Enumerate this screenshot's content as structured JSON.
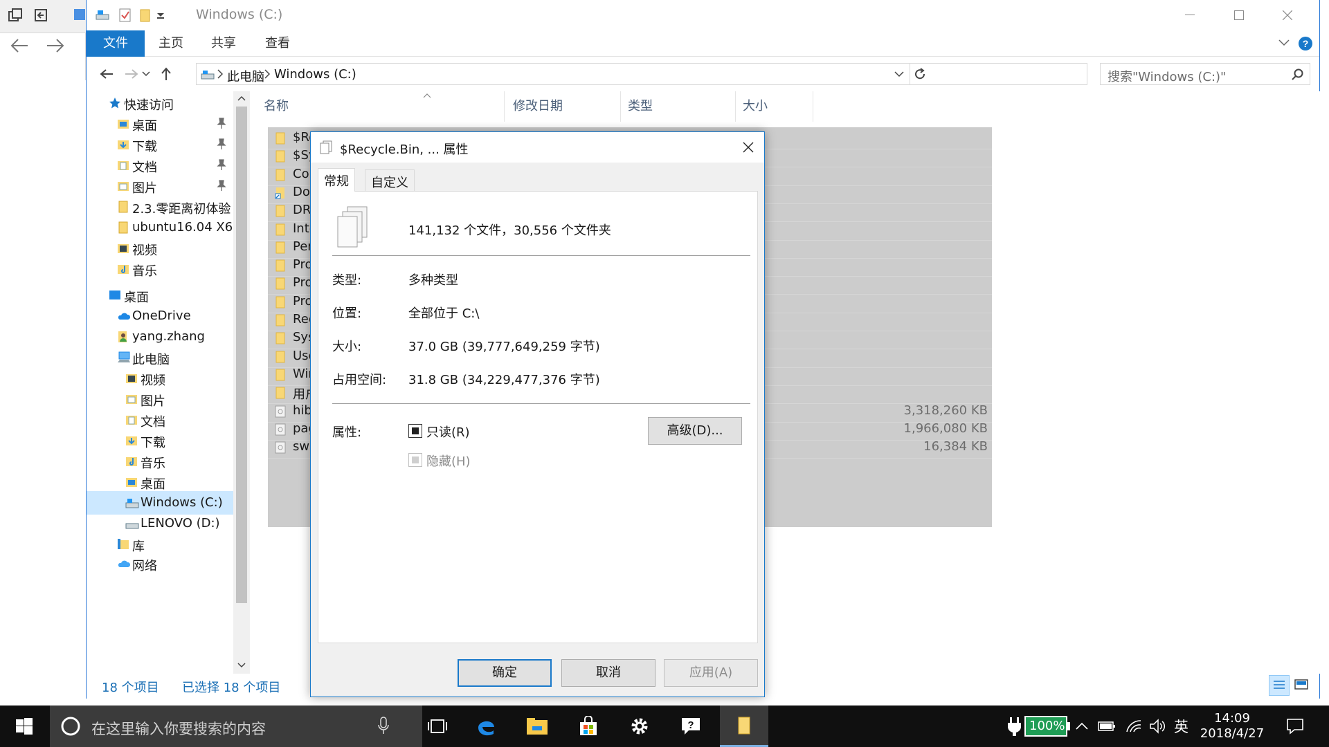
{
  "window": {
    "title": "Windows (C:)",
    "ribbon_tabs": [
      "文件",
      "主页",
      "共享",
      "查看"
    ]
  },
  "address": {
    "crumbs": [
      "此电脑",
      "Windows (C:)"
    ],
    "search_placeholder": "搜索\"Windows (C:)\""
  },
  "nav": {
    "quick_access": "快速访问",
    "items": [
      {
        "label": "桌面"
      },
      {
        "label": "下载"
      },
      {
        "label": "文档"
      },
      {
        "label": "图片"
      },
      {
        "label": "2.3.零距离初体验"
      },
      {
        "label": "ubuntu16.04 X6"
      },
      {
        "label": "视频"
      },
      {
        "label": "音乐"
      }
    ],
    "desktop": "桌面",
    "onedrive": "OneDrive",
    "user": "yang.zhang",
    "this_pc": "此电脑",
    "pc_items": [
      {
        "label": "视频"
      },
      {
        "label": "图片"
      },
      {
        "label": "文档"
      },
      {
        "label": "下载"
      },
      {
        "label": "音乐"
      },
      {
        "label": "桌面"
      },
      {
        "label": "Windows (C:)"
      },
      {
        "label": "LENOVO (D:)"
      }
    ],
    "library": "库",
    "network": "网络"
  },
  "columns": [
    "名称",
    "修改日期",
    "类型",
    "大小"
  ],
  "files": [
    {
      "name": "$Re",
      "size": ""
    },
    {
      "name": "$Sy",
      "size": ""
    },
    {
      "name": "Cor",
      "size": ""
    },
    {
      "name": "Doc",
      "size": ""
    },
    {
      "name": "DR",
      "size": ""
    },
    {
      "name": "Inte",
      "size": ""
    },
    {
      "name": "Per",
      "size": ""
    },
    {
      "name": "Pro",
      "size": ""
    },
    {
      "name": "Pro",
      "size": ""
    },
    {
      "name": "Pro",
      "size": ""
    },
    {
      "name": "Rec",
      "size": ""
    },
    {
      "name": "Sys",
      "size": ""
    },
    {
      "name": "Use",
      "size": ""
    },
    {
      "name": "Win",
      "size": ""
    },
    {
      "name": "用户",
      "size": ""
    },
    {
      "name": "hib",
      "size": "3,318,260 KB"
    },
    {
      "name": "pag",
      "size": "1,966,080 KB"
    },
    {
      "name": "swa",
      "size": "16,384 KB"
    }
  ],
  "status": {
    "count": "18 个项目",
    "selected": "已选择 18 个项目"
  },
  "dialog": {
    "title": "$Recycle.Bin, ... 属性",
    "tabs": [
      "常规",
      "自定义"
    ],
    "summary": "141,132 个文件，30,556 个文件夹",
    "type_label": "类型:",
    "type_value": "多种类型",
    "location_label": "位置:",
    "location_value": "全部位于 C:\\",
    "size_label": "大小:",
    "size_value": "37.0 GB (39,777,649,259 字节)",
    "disk_label": "占用空间:",
    "disk_value": "31.8 GB (34,229,477,376 字节)",
    "attr_label": "属性:",
    "readonly": "只读(R)",
    "hidden": "隐藏(H)",
    "advanced": "高级(D)...",
    "ok": "确定",
    "cancel": "取消",
    "apply": "应用(A)"
  },
  "taskbar": {
    "search_placeholder": "在这里输入你要搜索的内容",
    "battery": "100%",
    "ime": "英",
    "time": "14:09",
    "date": "2018/4/27"
  },
  "colors": {
    "accent": "#1979ca",
    "selection_bg": "#cce8ff",
    "taskbar_bg": "#101010"
  }
}
